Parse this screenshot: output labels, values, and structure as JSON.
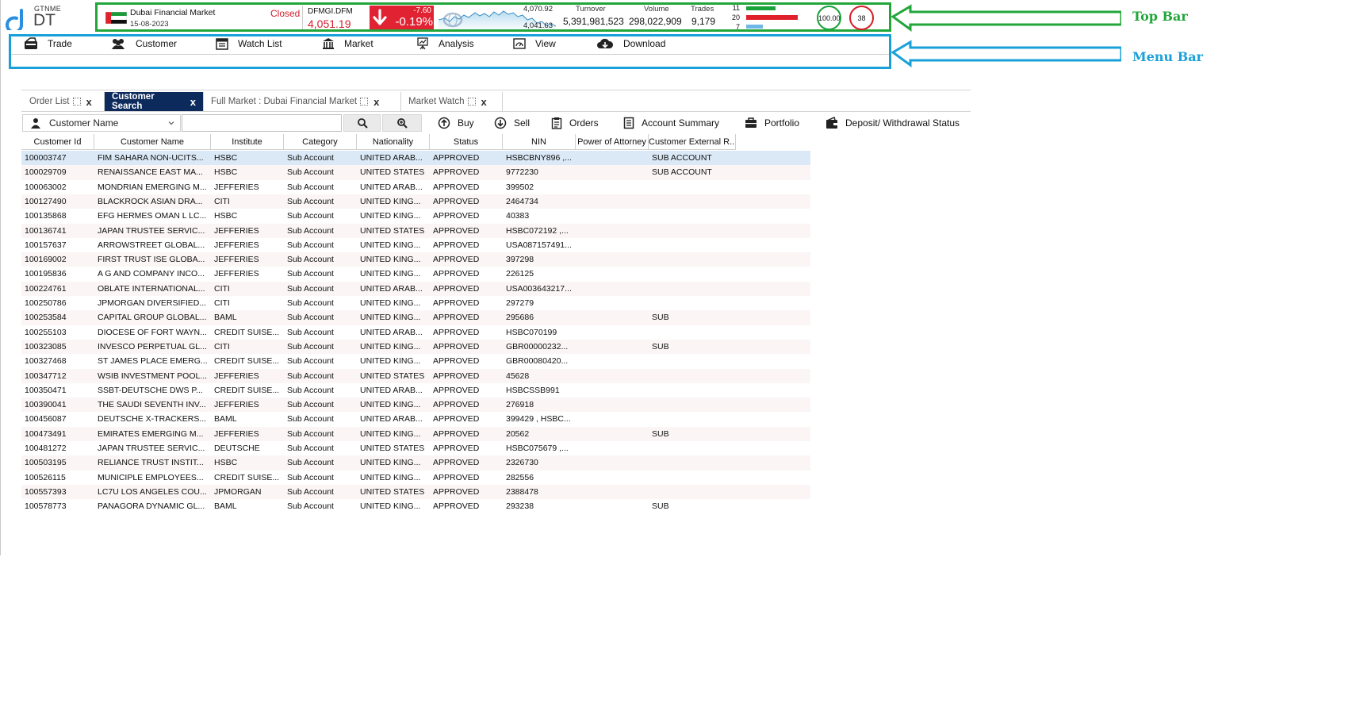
{
  "brand": {
    "top": "GTNME",
    "bottom": "DT"
  },
  "market": {
    "name": "Dubai Financial Market",
    "date": "15-08-2023",
    "status": "Closed"
  },
  "index": {
    "symbol": "DFMGI.DFM",
    "value": "4,051.19",
    "change": "-7.60",
    "change_pct": "-0.19%",
    "high": "4,070.92",
    "low": "4,041.63"
  },
  "stats": {
    "turnover_label": "Turnover",
    "turnover": "5,391,981,523",
    "volume_label": "Volume",
    "volume": "298,022,909",
    "trades_label": "Trades",
    "trades": "9,179"
  },
  "breadth": {
    "up": "11",
    "down": "20",
    "unchanged": "7",
    "up_color": "#1aa23a",
    "down_color": "#e0202a",
    "unchanged_color": "#6fb7e6"
  },
  "indicators": {
    "green_ring": "100.00",
    "red_ring": "38"
  },
  "annotations": {
    "top_bar": "Top Bar",
    "menu_bar": "Menu Bar",
    "top_bar_color": "#22a63a",
    "menu_bar_color": "#1aa0d8"
  },
  "menu": [
    {
      "label": "Trade",
      "icon": "trade-icon"
    },
    {
      "label": "Customer",
      "icon": "customer-icon"
    },
    {
      "label": "Watch List",
      "icon": "watchlist-icon"
    },
    {
      "label": "Market",
      "icon": "market-icon"
    },
    {
      "label": "Analysis",
      "icon": "analysis-icon"
    },
    {
      "label": "View",
      "icon": "view-icon"
    },
    {
      "label": "Download",
      "icon": "download-icon"
    }
  ],
  "tabs": [
    {
      "label": "Order List",
      "close": "x",
      "active": false
    },
    {
      "label": "Customer Search",
      "close": "x",
      "active": true
    },
    {
      "label": "Full Market : Dubai Financial Market",
      "close": "x",
      "active": false
    },
    {
      "label": "Market Watch",
      "close": "x",
      "active": false
    }
  ],
  "search": {
    "type": "Customer Name",
    "value": ""
  },
  "actions": [
    {
      "label": "Buy",
      "icon": "buy-icon"
    },
    {
      "label": "Sell",
      "icon": "sell-icon"
    },
    {
      "label": "Orders",
      "icon": "orders-icon"
    },
    {
      "label": "Account Summary",
      "icon": "account-summary-icon"
    },
    {
      "label": "Portfolio",
      "icon": "portfolio-icon"
    },
    {
      "label": "Deposit/ Withdrawal Status",
      "icon": "wallet-icon"
    }
  ],
  "table": {
    "columns": [
      "Customer Id",
      "Customer Name",
      "Institute",
      "Category",
      "Nationality",
      "Status",
      "NIN",
      "Power of Attorney",
      "Customer External R..."
    ],
    "rows": [
      [
        "100003747",
        "FIM SAHARA NON-UCITS...",
        "HSBC",
        "Sub Account",
        "UNITED ARAB...",
        "APPROVED",
        "HSBCBNY896 ,...",
        "",
        "SUB ACCOUNT"
      ],
      [
        "100029709",
        "RENAISSANCE EAST MA...",
        "HSBC",
        "Sub Account",
        "UNITED STATES",
        "APPROVED",
        "9772230",
        "",
        "SUB ACCOUNT"
      ],
      [
        "100063002",
        "MONDRIAN EMERGING M...",
        "JEFFERIES",
        "Sub Account",
        "UNITED ARAB...",
        "APPROVED",
        "399502",
        "",
        ""
      ],
      [
        "100127490",
        "BLACKROCK ASIAN DRA...",
        "CITI",
        "Sub Account",
        "UNITED KING...",
        "APPROVED",
        "2464734",
        "",
        ""
      ],
      [
        "100135868",
        "EFG HERMES OMAN L LC...",
        "HSBC",
        "Sub Account",
        "UNITED KING...",
        "APPROVED",
        "40383",
        "",
        ""
      ],
      [
        "100136741",
        "JAPAN TRUSTEE SERVIC...",
        "JEFFERIES",
        "Sub Account",
        "UNITED STATES",
        "APPROVED",
        "HSBC072192 ,...",
        "",
        ""
      ],
      [
        "100157637",
        "ARROWSTREET GLOBAL...",
        "JEFFERIES",
        "Sub Account",
        "UNITED KING...",
        "APPROVED",
        "USA087157491...",
        "",
        ""
      ],
      [
        "100169002",
        "FIRST TRUST ISE GLOBA...",
        "JEFFERIES",
        "Sub Account",
        "UNITED KING...",
        "APPROVED",
        "397298",
        "",
        ""
      ],
      [
        "100195836",
        "A G AND COMPANY INCO...",
        "JEFFERIES",
        "Sub Account",
        "UNITED KING...",
        "APPROVED",
        "226125",
        "",
        ""
      ],
      [
        "100224761",
        "OBLATE INTERNATIONAL...",
        "CITI",
        "Sub Account",
        "UNITED ARAB...",
        "APPROVED",
        "USA003643217...",
        "",
        ""
      ],
      [
        "100250786",
        "JPMORGAN DIVERSIFIED...",
        "CITI",
        "Sub Account",
        "UNITED KING...",
        "APPROVED",
        "297279",
        "",
        ""
      ],
      [
        "100253584",
        "CAPITAL GROUP GLOBAL...",
        "BAML",
        "Sub Account",
        "UNITED KING...",
        "APPROVED",
        "295686",
        "",
        "SUB"
      ],
      [
        "100255103",
        "DIOCESE OF FORT WAYN...",
        "CREDIT SUISE...",
        "Sub Account",
        "UNITED ARAB...",
        "APPROVED",
        "HSBC070199",
        "",
        ""
      ],
      [
        "100323085",
        "INVESCO PERPETUAL GL...",
        "CITI",
        "Sub Account",
        "UNITED KING...",
        "APPROVED",
        "GBR00000232...",
        "",
        "SUB"
      ],
      [
        "100327468",
        "ST JAMES PLACE EMERG...",
        "CREDIT SUISE...",
        "Sub Account",
        "UNITED KING...",
        "APPROVED",
        "GBR00080420...",
        "",
        ""
      ],
      [
        "100347712",
        "WSIB INVESTMENT POOL...",
        "JEFFERIES",
        "Sub Account",
        "UNITED STATES",
        "APPROVED",
        "45628",
        "",
        ""
      ],
      [
        "100350471",
        "SSBT-DEUTSCHE DWS P...",
        "CREDIT SUISE...",
        "Sub Account",
        "UNITED ARAB...",
        "APPROVED",
        "HSBCSSB991",
        "",
        ""
      ],
      [
        "100390041",
        "THE SAUDI SEVENTH INV...",
        "JEFFERIES",
        "Sub Account",
        "UNITED KING...",
        "APPROVED",
        "276918",
        "",
        ""
      ],
      [
        "100456087",
        "DEUTSCHE X-TRACKERS...",
        "BAML",
        "Sub Account",
        "UNITED ARAB...",
        "APPROVED",
        "399429 , HSBC...",
        "",
        ""
      ],
      [
        "100473491",
        "EMIRATES EMERGING M...",
        "JEFFERIES",
        "Sub Account",
        "UNITED KING...",
        "APPROVED",
        "20562",
        "",
        "SUB"
      ],
      [
        "100481272",
        "JAPAN TRUSTEE SERVIC...",
        "DEUTSCHE",
        "Sub Account",
        "UNITED STATES",
        "APPROVED",
        "HSBC075679 ,...",
        "",
        ""
      ],
      [
        "100503195",
        "RELIANCE TRUST INSTIT...",
        "HSBC",
        "Sub Account",
        "UNITED KING...",
        "APPROVED",
        "2326730",
        "",
        ""
      ],
      [
        "100526115",
        "MUNICIPLE EMPLOYEES...",
        "CREDIT SUISE...",
        "Sub Account",
        "UNITED KING...",
        "APPROVED",
        "282556",
        "",
        ""
      ],
      [
        "100557393",
        "LC7U LOS ANGELES COU...",
        "JPMORGAN",
        "Sub Account",
        "UNITED STATES",
        "APPROVED",
        "2388478",
        "",
        ""
      ],
      [
        "100578773",
        "PANAGORA DYNAMIC GL...",
        "BAML",
        "Sub Account",
        "UNITED KING...",
        "APPROVED",
        "293238",
        "",
        "SUB"
      ]
    ]
  }
}
